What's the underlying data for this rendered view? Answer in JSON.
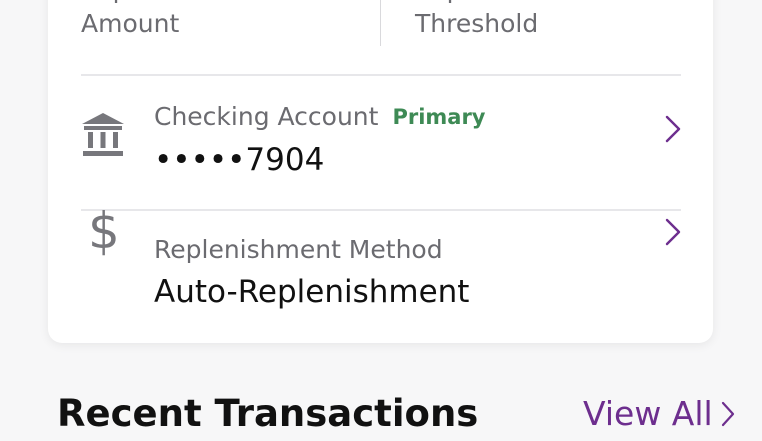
{
  "summary": {
    "amount_label": "Replenishment Amount",
    "threshold_label": "Replenishment Threshold"
  },
  "account": {
    "label": "Checking Account",
    "badge": "Primary",
    "number": "•••••7904",
    "icon": "bank-icon"
  },
  "method": {
    "label": "Replenishment Method",
    "value": "Auto-Replenishment",
    "icon": "dollar-icon"
  },
  "transactions": {
    "title": "Recent Transactions",
    "view_all": "View All"
  },
  "colors": {
    "accent": "#6d2e8e",
    "primary_badge": "#3e8a55",
    "secondary_text": "#6b6b70",
    "text": "#111111"
  }
}
